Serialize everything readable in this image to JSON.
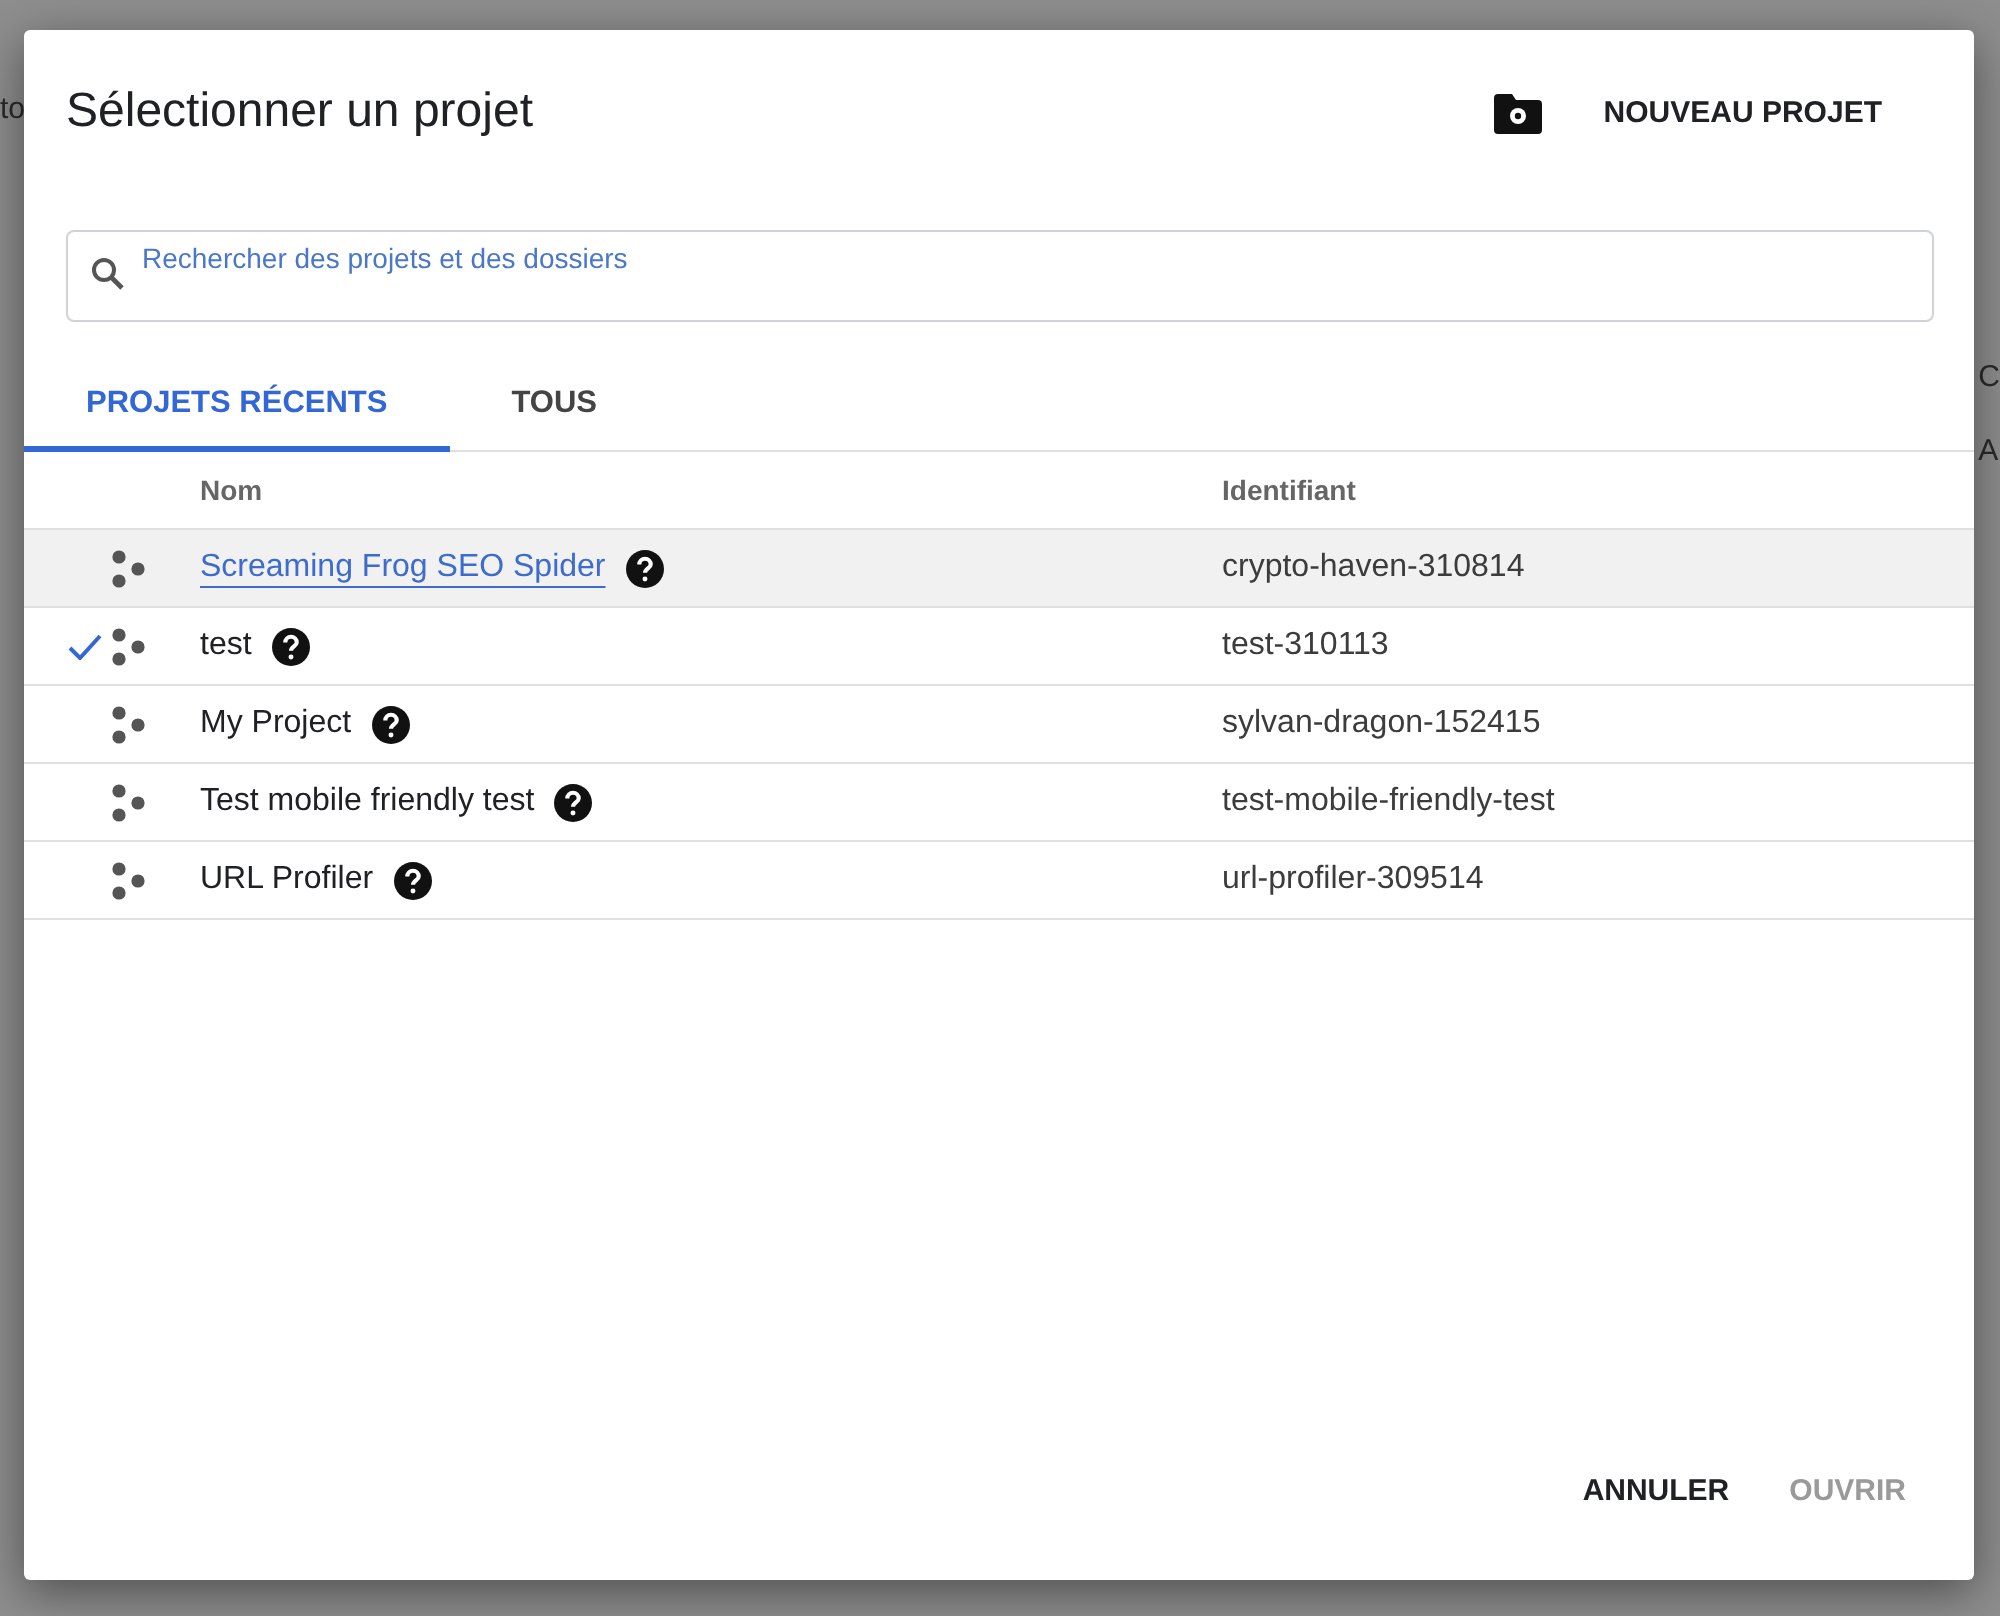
{
  "background": {
    "left_texts": [
      "to"
    ],
    "right_texts": [
      "C",
      "A"
    ]
  },
  "dialog": {
    "title": "Sélectionner un projet",
    "new_project_button": "NOUVEAU PROJET",
    "search": {
      "placeholder": "Rechercher des projets et des dossiers"
    },
    "tabs": [
      {
        "label": "PROJETS RÉCENTS",
        "selected": true
      },
      {
        "label": "TOUS",
        "selected": false
      }
    ],
    "table": {
      "columns": [
        "Nom",
        "Identifiant"
      ],
      "rows": [
        {
          "name": "Screaming Frog SEO Spider",
          "id": "crypto-haven-310814",
          "selected": false,
          "hovered": true
        },
        {
          "name": "test",
          "id": "test-310113",
          "selected": true,
          "hovered": false
        },
        {
          "name": "My Project",
          "id": "sylvan-dragon-152415",
          "selected": false,
          "hovered": false
        },
        {
          "name": "Test mobile friendly test",
          "id": "test-mobile-friendly-test",
          "selected": false,
          "hovered": false
        },
        {
          "name": "URL Profiler",
          "id": "url-profiler-309514",
          "selected": false,
          "hovered": false
        }
      ]
    },
    "buttons": [
      {
        "label": "ANNULER",
        "disabled": false
      },
      {
        "label": "OUVRIR",
        "disabled": true
      }
    ]
  }
}
